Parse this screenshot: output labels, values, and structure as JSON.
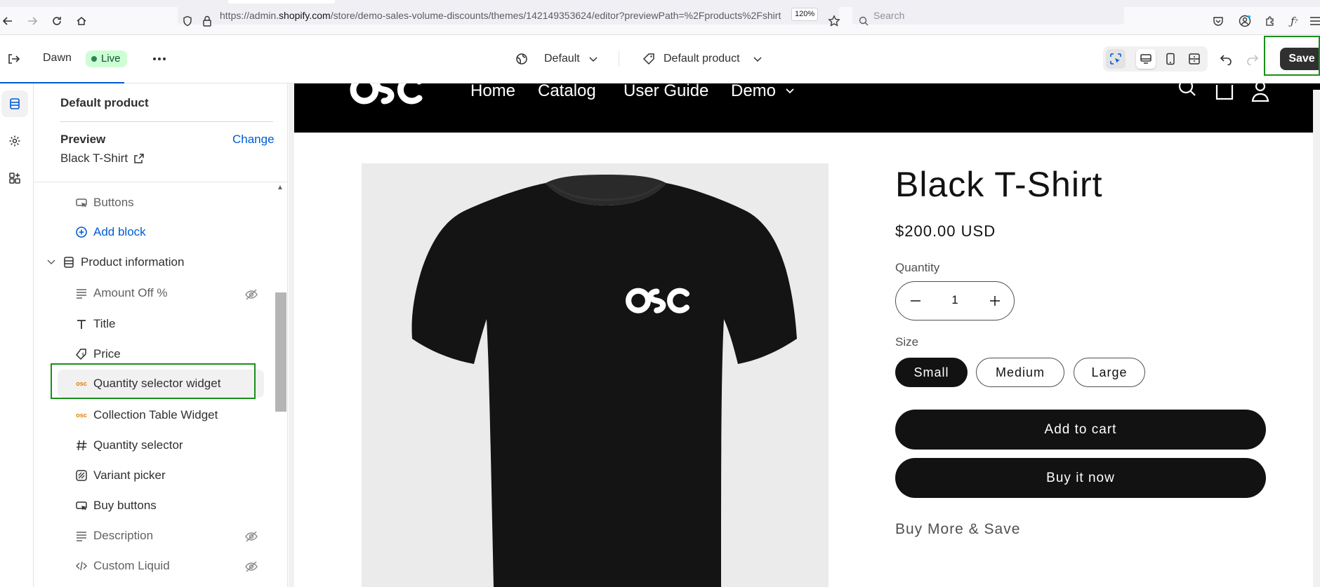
{
  "browser": {
    "url_prefix": "https://admin.",
    "url_domain": "shopify.com",
    "url_rest": "/store/demo-sales-volume-discounts/themes/142149353624/editor?previewPath=%2Fproducts%2Fshirt",
    "zoom": "120%",
    "search_placeholder": "Search"
  },
  "editor": {
    "theme_name": "Dawn",
    "live_badge": "Live",
    "template_select": "Default",
    "page_select": "Default product",
    "save_label": "Save"
  },
  "sidebar": {
    "title": "Default product",
    "preview_label": "Preview",
    "change_label": "Change",
    "preview_product": "Black T-Shirt",
    "items": [
      {
        "label": "Buttons",
        "icon": "buttons-icon",
        "hidden": false
      },
      {
        "label": "Add block",
        "icon": "add-circle-icon",
        "hidden": false
      },
      {
        "label": "Product information",
        "icon": "section-icon",
        "hidden": false
      },
      {
        "label": "Amount Off %",
        "icon": "text-lines-icon",
        "hidden": true
      },
      {
        "label": "Title",
        "icon": "title-t-icon",
        "hidden": false
      },
      {
        "label": "Price",
        "icon": "price-tag-icon",
        "hidden": false
      },
      {
        "label": "Quantity selector widget",
        "icon": "osc-app-icon",
        "hidden": false
      },
      {
        "label": "Collection Table Widget",
        "icon": "osc-app-icon",
        "hidden": false
      },
      {
        "label": "Quantity selector",
        "icon": "hash-icon",
        "hidden": false
      },
      {
        "label": "Variant picker",
        "icon": "variant-icon",
        "hidden": false
      },
      {
        "label": "Buy buttons",
        "icon": "buttons-icon",
        "hidden": false
      },
      {
        "label": "Description",
        "icon": "text-lines-icon",
        "hidden": true
      },
      {
        "label": "Custom Liquid",
        "icon": "code-icon",
        "hidden": true
      }
    ]
  },
  "store": {
    "nav": [
      "Home",
      "Catalog",
      "User Guide",
      "Demo"
    ],
    "product": {
      "title": "Black T-Shirt",
      "price": "$200.00 USD",
      "quantity_label": "Quantity",
      "quantity_value": "1",
      "size_label": "Size",
      "sizes": [
        "Small",
        "Medium",
        "Large"
      ],
      "selected_size": "Small",
      "add_to_cart": "Add to cart",
      "buy_now": "Buy it now",
      "buy_more": "Buy More & Save"
    }
  },
  "colors": {
    "save_button": "#303030",
    "highlight_box": "#1a8f1a",
    "link": "#005bd3",
    "live_badge_bg": "#cdfed4"
  }
}
